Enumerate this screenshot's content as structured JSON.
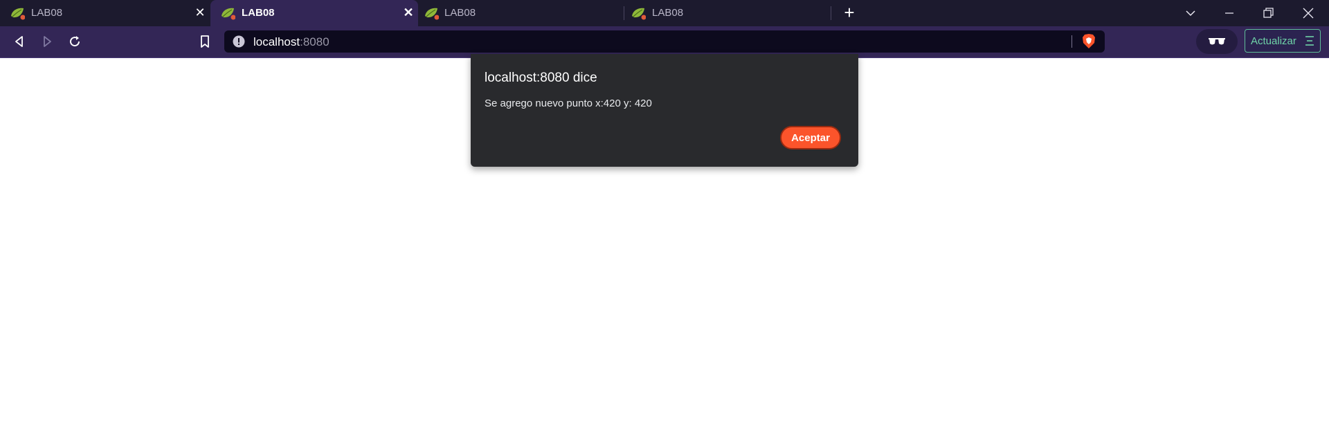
{
  "tabs": [
    {
      "title": "LAB08",
      "active": false,
      "has_close": true
    },
    {
      "title": "LAB08",
      "active": true,
      "has_close": true
    },
    {
      "title": "LAB08",
      "active": false,
      "has_close": false
    },
    {
      "title": "LAB08",
      "active": false,
      "has_close": false
    }
  ],
  "tab_favicon": "spring-leaf-icon",
  "address_bar": {
    "host": "localhost",
    "port": ":8080"
  },
  "update_button": {
    "label": "Actualizar"
  },
  "dialog": {
    "title": "localhost:8080 dice",
    "message": "Se agrego nuevo punto x:420 y: 420",
    "accept_label": "Aceptar"
  },
  "colors": {
    "accent": "#fb542b",
    "toolbar_bg": "#332656",
    "tabstrip_bg": "#1c1a2e",
    "dialog_bg": "#292a2d",
    "update_green": "#6fd3a8"
  }
}
